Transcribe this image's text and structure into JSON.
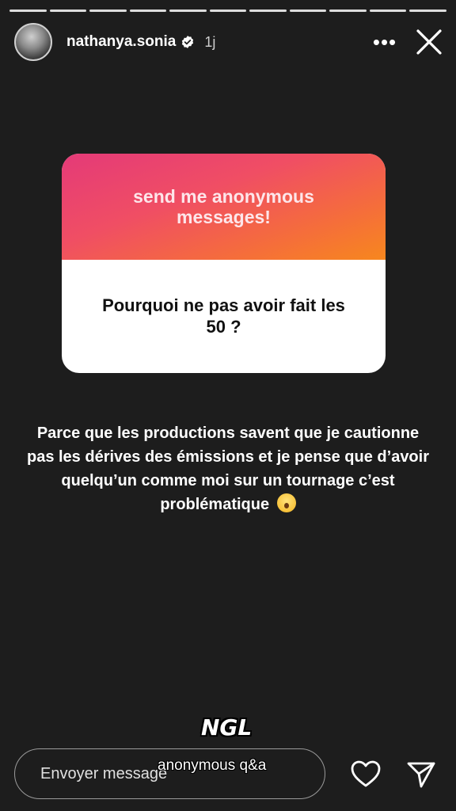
{
  "story": {
    "segments_total": 11,
    "segments_viewed": 11
  },
  "header": {
    "username": "nathanya.sonia",
    "time": "1j",
    "more_label": "•••"
  },
  "card": {
    "prompt": "send me anonymous messages!",
    "question": "Pourquoi ne pas avoir fait les 50 ?",
    "gradient_colors": [
      "#e43a78",
      "#f56e3a",
      "#f7871e"
    ]
  },
  "answer": {
    "text": "Parce que les productions savent que je cautionne pas les dérives des émissions et je pense que d’avoir quelqu’un comme moi sur un tournage c’est problématique",
    "emoji": "hand-over-mouth-emoji"
  },
  "branding": {
    "logo": "NGL",
    "subtitle": "anonymous q&a"
  },
  "footer": {
    "reply_placeholder": "Envoyer message"
  },
  "colors": {
    "background": "#1d1d1d",
    "text": "#ffffff"
  }
}
